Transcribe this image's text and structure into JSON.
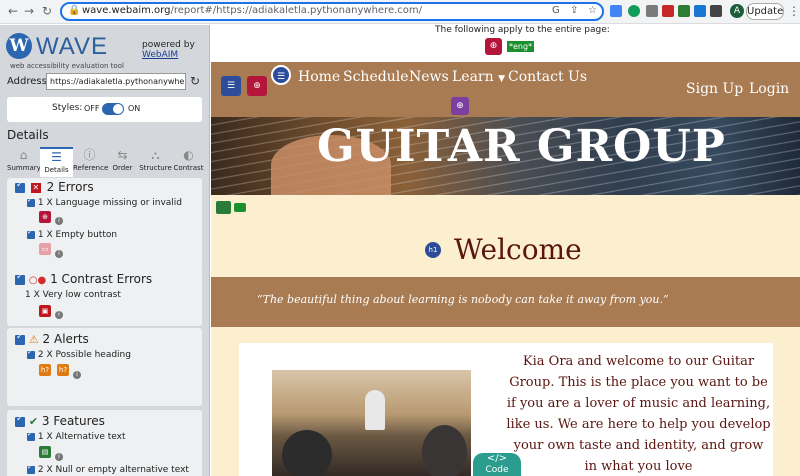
{
  "browser": {
    "url_host": "wave.webaim.org",
    "url_rest": "/report#/https://adiakaletla.pythonanywhere.com/",
    "update_label": "Update",
    "avatar_letter": "A"
  },
  "wave": {
    "logo_letter": "W",
    "logo_word": "WAVE",
    "logo_sub": "web accessibility evaluation tool",
    "powered_by": "powered by",
    "powered_link": "WebAIM",
    "address_label": "Address:",
    "address_value": "https://adiakaletla.pythonanywhere.com/",
    "styles_label": "Styles:",
    "styles_off": "OFF",
    "styles_on": "ON",
    "styles_enabled": true,
    "details_title": "Details",
    "tabs": [
      {
        "label": "Summary",
        "icon": "home-icon",
        "glyph": "⌂"
      },
      {
        "label": "Details",
        "icon": "list-icon",
        "glyph": "☰"
      },
      {
        "label": "Reference",
        "icon": "info-icon",
        "glyph": "ⓘ"
      },
      {
        "label": "Order",
        "icon": "order-icon",
        "glyph": "⇆"
      },
      {
        "label": "Structure",
        "icon": "structure-icon",
        "glyph": "⛬"
      },
      {
        "label": "Contrast",
        "icon": "contrast-icon",
        "glyph": "◐"
      }
    ],
    "sections": {
      "errors": {
        "title": "2 Errors",
        "items": [
          "1 X Language missing or invalid",
          "1 X Empty button"
        ]
      },
      "contrast": {
        "title": "1 Contrast Errors",
        "items": [
          "1 X Very low contrast"
        ]
      },
      "alerts": {
        "title": "2 Alerts",
        "items": [
          "2 X Possible heading"
        ]
      },
      "features": {
        "title": "3 Features",
        "items": [
          "1 X Alternative text",
          "2 X Null or empty alternative text"
        ]
      }
    },
    "colors": {
      "error": "#c0171f",
      "contrast": "#d22c2c",
      "alert": "#e07b12",
      "feature": "#2a7a3a",
      "accent": "#2d66b0"
    }
  },
  "page": {
    "applies_text": "The following apply to the entire page:",
    "lang_badge": "*eng*",
    "nav": [
      "Home",
      "Schedule",
      "News",
      "Learn",
      "Contact Us"
    ],
    "nav_right": [
      "Sign Up",
      "Login"
    ],
    "hero_title": "GUITAR GROUP",
    "heading_badge": "h1",
    "welcome": "Welcome",
    "quote": "“The beautiful thing about learning is nobody can take it away from you.”",
    "body_text": "Kia Ora and welcome to our Guitar Group. This is the place you want to be if you are a lover of music and learning, like us. We are here to help you develop your own taste and identity, and grow in what you love",
    "code_label": "Code"
  }
}
